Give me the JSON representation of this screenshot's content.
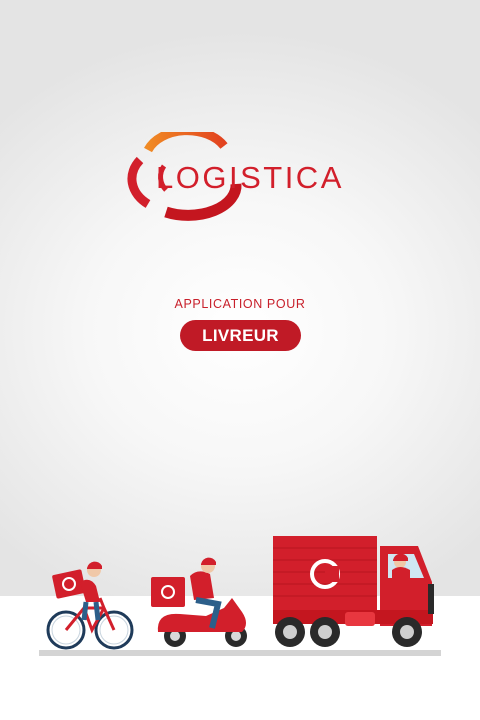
{
  "brand": {
    "name": "LOGISTICA",
    "primary_color": "#d21f2b",
    "accent_color": "#e8612a"
  },
  "intro": {
    "tagline": "APPLICATION POUR",
    "role": "LIVREUR"
  },
  "illustration": {
    "vehicles": [
      "bicycle-courier",
      "scooter-courier",
      "delivery-truck"
    ]
  },
  "icons": {
    "logo_emblem": "logo-c-emblem",
    "box_badge": "logo-badge-icon"
  }
}
